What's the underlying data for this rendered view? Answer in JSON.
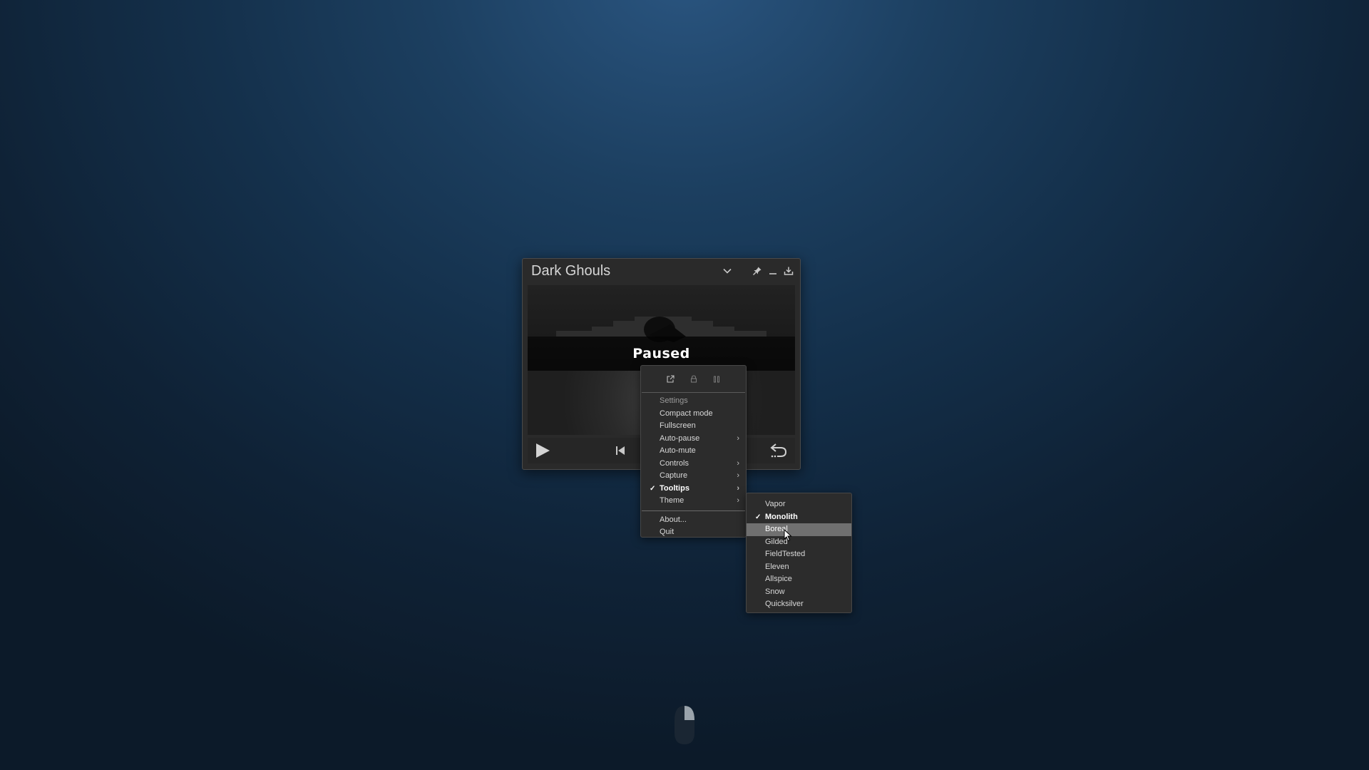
{
  "window": {
    "title": "Dark Ghouls",
    "icons": [
      "chevron-down-icon",
      "pin-icon",
      "minimize-icon",
      "download-icon"
    ]
  },
  "video": {
    "status": "Paused"
  },
  "controls": {
    "icons": [
      "play-icon",
      "skip-previous-icon",
      "replay-icon"
    ]
  },
  "context_menu": {
    "icon_row": [
      "external-link-icon",
      "lock-icon",
      "pause-icon"
    ],
    "header": "Settings",
    "items": [
      {
        "label": "Compact mode",
        "checked": false,
        "submenu": false
      },
      {
        "label": "Fullscreen",
        "checked": false,
        "submenu": false
      },
      {
        "label": "Auto-pause",
        "checked": false,
        "submenu": true
      },
      {
        "label": "Auto-mute",
        "checked": false,
        "submenu": false
      },
      {
        "label": "Controls",
        "checked": false,
        "submenu": true
      },
      {
        "label": "Capture",
        "checked": false,
        "submenu": true
      },
      {
        "label": "Tooltips",
        "checked": true,
        "submenu": true
      },
      {
        "label": "Theme",
        "checked": false,
        "submenu": true
      }
    ],
    "footer_items": [
      {
        "label": "About..."
      },
      {
        "label": "Quit"
      }
    ]
  },
  "theme_submenu": {
    "items": [
      {
        "label": "Vapor",
        "checked": false,
        "hovered": false
      },
      {
        "label": "Monolith",
        "checked": true,
        "hovered": false
      },
      {
        "label": "Boreal",
        "checked": false,
        "hovered": true
      },
      {
        "label": "Gilded",
        "checked": false,
        "hovered": false
      },
      {
        "label": "FieldTested",
        "checked": false,
        "hovered": false
      },
      {
        "label": "Eleven",
        "checked": false,
        "hovered": false
      },
      {
        "label": "Allspice",
        "checked": false,
        "hovered": false
      },
      {
        "label": "Snow",
        "checked": false,
        "hovered": false
      },
      {
        "label": "Quicksilver",
        "checked": false,
        "hovered": false
      }
    ]
  },
  "colors": {
    "menu_bg": "#2c2c2c",
    "hover_bg": "#707070",
    "window_bg": "#2a2a2a"
  }
}
